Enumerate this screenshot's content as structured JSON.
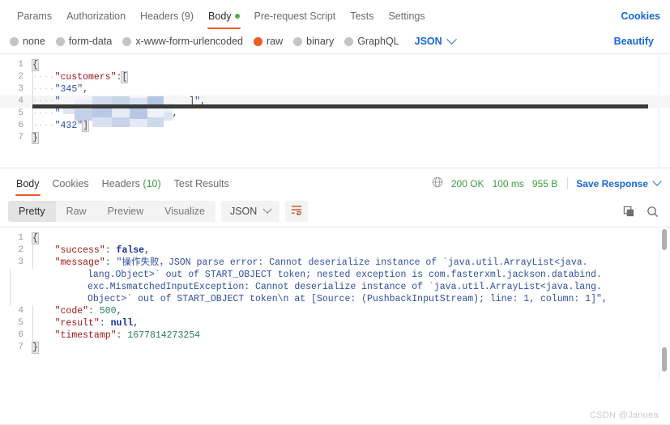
{
  "request": {
    "tabs": [
      {
        "label": "Params",
        "active": false,
        "dot": false
      },
      {
        "label": "Authorization",
        "active": false,
        "dot": false
      },
      {
        "label": "Headers (9)",
        "active": false,
        "dot": false
      },
      {
        "label": "Body",
        "active": true,
        "dot": true
      },
      {
        "label": "Pre-request Script",
        "active": false,
        "dot": false
      },
      {
        "label": "Tests",
        "active": false,
        "dot": false
      },
      {
        "label": "Settings",
        "active": false,
        "dot": false
      }
    ],
    "cookies_label": "Cookies",
    "body_types": [
      {
        "label": "none",
        "selected": false
      },
      {
        "label": "form-data",
        "selected": false
      },
      {
        "label": "x-www-form-urlencoded",
        "selected": false
      },
      {
        "label": "raw",
        "selected": true
      },
      {
        "label": "binary",
        "selected": false
      },
      {
        "label": "GraphQL",
        "selected": false
      }
    ],
    "format_selected": "JSON",
    "beautify_label": "Beautify",
    "body_lines": [
      {
        "n": "1",
        "text": "{"
      },
      {
        "n": "2",
        "text": "    \"customers\":["
      },
      {
        "n": "3",
        "text": "    \"345\","
      },
      {
        "n": "4",
        "text": "    \"",
        "redacted": true,
        "tail": "]\","
      },
      {
        "n": "5",
        "text": "    \"",
        "redacted": true,
        "tail": ","
      },
      {
        "n": "6",
        "text": "    \"432\"]"
      },
      {
        "n": "7",
        "text": "}"
      }
    ]
  },
  "response": {
    "tabs": [
      {
        "label": "Body",
        "active": true
      },
      {
        "label": "Cookies",
        "active": false
      },
      {
        "label": "Headers (10)",
        "active": false
      },
      {
        "label": "Test Results",
        "active": false
      }
    ],
    "headers_prefix": "Headers ",
    "headers_count": "(10)",
    "status": "200 OK",
    "time": "100 ms",
    "size": "955 B",
    "save_label": "Save Response",
    "view_modes": [
      {
        "label": "Pretty",
        "active": true
      },
      {
        "label": "Raw",
        "active": false
      },
      {
        "label": "Preview",
        "active": false
      },
      {
        "label": "Visualize",
        "active": false
      }
    ],
    "format_selected": "JSON",
    "icons": {
      "globe": "globe-icon",
      "wrap": "wrap-lines-icon",
      "copy": "copy-icon",
      "search": "search-icon"
    },
    "body": {
      "line1": "{",
      "line2_key": "\"success\"",
      "line2_val": "false",
      "line3_key": "\"message\"",
      "line3_val_a": "\"操作失败，JSON parse error: Cannot deserialize instance of `java.util.ArrayList<java.",
      "line3_val_b": "lang.Object>` out of START_OBJECT token; nested exception is com.fasterxml.jackson.databind.",
      "line3_val_c": "exc.MismatchedInputException: Cannot deserialize instance of `java.util.ArrayList<java.lang.",
      "line3_val_d": "Object>` out of START_OBJECT token\\n at [Source: (PushbackInputStream); line: 1, column: 1]\",",
      "line4_key": "\"code\"",
      "line4_val": "500",
      "line5_key": "\"result\"",
      "line5_val": "null",
      "line6_key": "\"timestamp\"",
      "line6_val": "1677814273254",
      "line7": "}",
      "numbers": [
        "1",
        "2",
        "3",
        "4",
        "5",
        "6",
        "7"
      ]
    }
  },
  "watermark": "CSDN @Januea",
  "colors": {
    "accent": "#ef5b25",
    "link": "#1668d7",
    "ok": "#3a9e3a",
    "key": "#a31515",
    "string": "#2f4f9f",
    "number": "#2a7f62"
  }
}
